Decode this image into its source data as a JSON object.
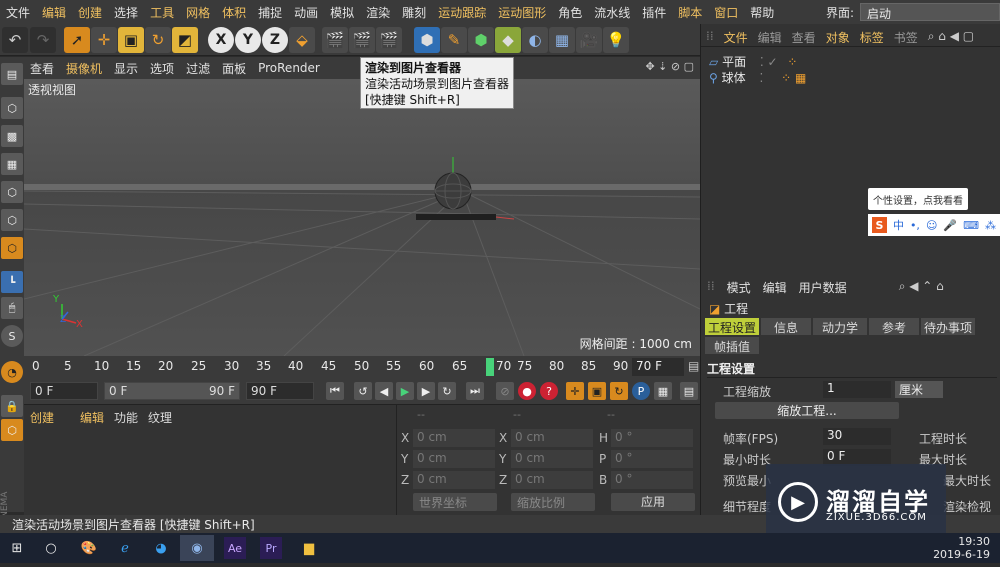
{
  "menubar": {
    "items": [
      "文件",
      "编辑",
      "创建",
      "选择",
      "工具",
      "网格",
      "体积",
      "捕捉",
      "动画",
      "模拟",
      "渲染",
      "雕刻",
      "运动跟踪",
      "运动图形",
      "角色",
      "流水线",
      "插件",
      "脚本",
      "窗口",
      "帮助"
    ],
    "layout_label": "界面:",
    "layout_value": "启动"
  },
  "viewport": {
    "menu": [
      "查看",
      "摄像机",
      "显示",
      "选项",
      "过滤",
      "面板",
      "ProRender"
    ],
    "view_name": "透视视图",
    "grid_spacing": "网格间距 : 1000 cm",
    "axis_labels": {
      "x": "X",
      "y": "Y",
      "z": "Z"
    }
  },
  "tooltip": {
    "title": "渲染到图片查看器",
    "desc": "渲染活动场景到图片查看器",
    "shortcut": "[快捷键 Shift+R]"
  },
  "timeline": {
    "ticks": [
      "0",
      "5",
      "10",
      "15",
      "20",
      "25",
      "30",
      "35",
      "40",
      "45",
      "50",
      "55",
      "60",
      "65",
      "70",
      "75",
      "80",
      "85",
      "90"
    ],
    "current_frame": "70 F"
  },
  "transport": {
    "start": "0 F",
    "range_start": "0 F",
    "range_end": "90 F",
    "end": "90 F"
  },
  "material": {
    "menu": [
      "创建",
      "编辑",
      "功能",
      "纹理"
    ]
  },
  "coords": {
    "headers": [
      "--",
      "--",
      "--"
    ],
    "rows": [
      {
        "l1": "X",
        "v1": "0 cm",
        "l2": "X",
        "v2": "0 cm",
        "l3": "H",
        "v3": "0 °"
      },
      {
        "l1": "Y",
        "v1": "0 cm",
        "l2": "Y",
        "v2": "0 cm",
        "l3": "P",
        "v3": "0 °"
      },
      {
        "l1": "Z",
        "v1": "0 cm",
        "l2": "Z",
        "v2": "0 cm",
        "l3": "B",
        "v3": "0 °"
      }
    ],
    "world_coord": "世界坐标",
    "scale_mode": "缩放比例",
    "apply": "应用"
  },
  "objects": {
    "menu": [
      "文件",
      "编辑",
      "查看",
      "对象",
      "标签",
      "书签"
    ],
    "items": [
      {
        "name": "平面"
      },
      {
        "name": "球体"
      }
    ]
  },
  "attributes": {
    "menu": [
      "模式",
      "编辑",
      "用户数据"
    ],
    "title": "工程",
    "tabs": [
      "工程设置",
      "信息",
      "动力学",
      "参考",
      "待办事项",
      "帧插值"
    ],
    "section": "工程设置",
    "project_scale_label": "工程缩放",
    "project_scale_value": "1",
    "project_scale_unit": "厘米",
    "scale_button": "缩放工程...",
    "fps_label": "帧率(FPS)",
    "fps_value": "30",
    "project_length_label": "工程时长",
    "min_time_label": "最小时长",
    "min_time_value": "0 F",
    "max_time_label": "最大时长",
    "preview_min_label": "预览最小",
    "preview_max_label": "最大时长",
    "lod_label": "细节程度",
    "render_lod_label": "渲染检视"
  },
  "status": {
    "text": "渲染活动场景到图片查看器 [快捷键 Shift+R]"
  },
  "ime": {
    "tip": "个性设置，点我看看",
    "logo": "S",
    "lang": "中"
  },
  "watermark": {
    "name": "溜溜自学",
    "url": "ZIXUE.3D66.COM"
  },
  "taskbar": {
    "time": "19:30",
    "date": "2019-6-19",
    "ae_label": "Ae",
    "pr_label": "Pr"
  }
}
